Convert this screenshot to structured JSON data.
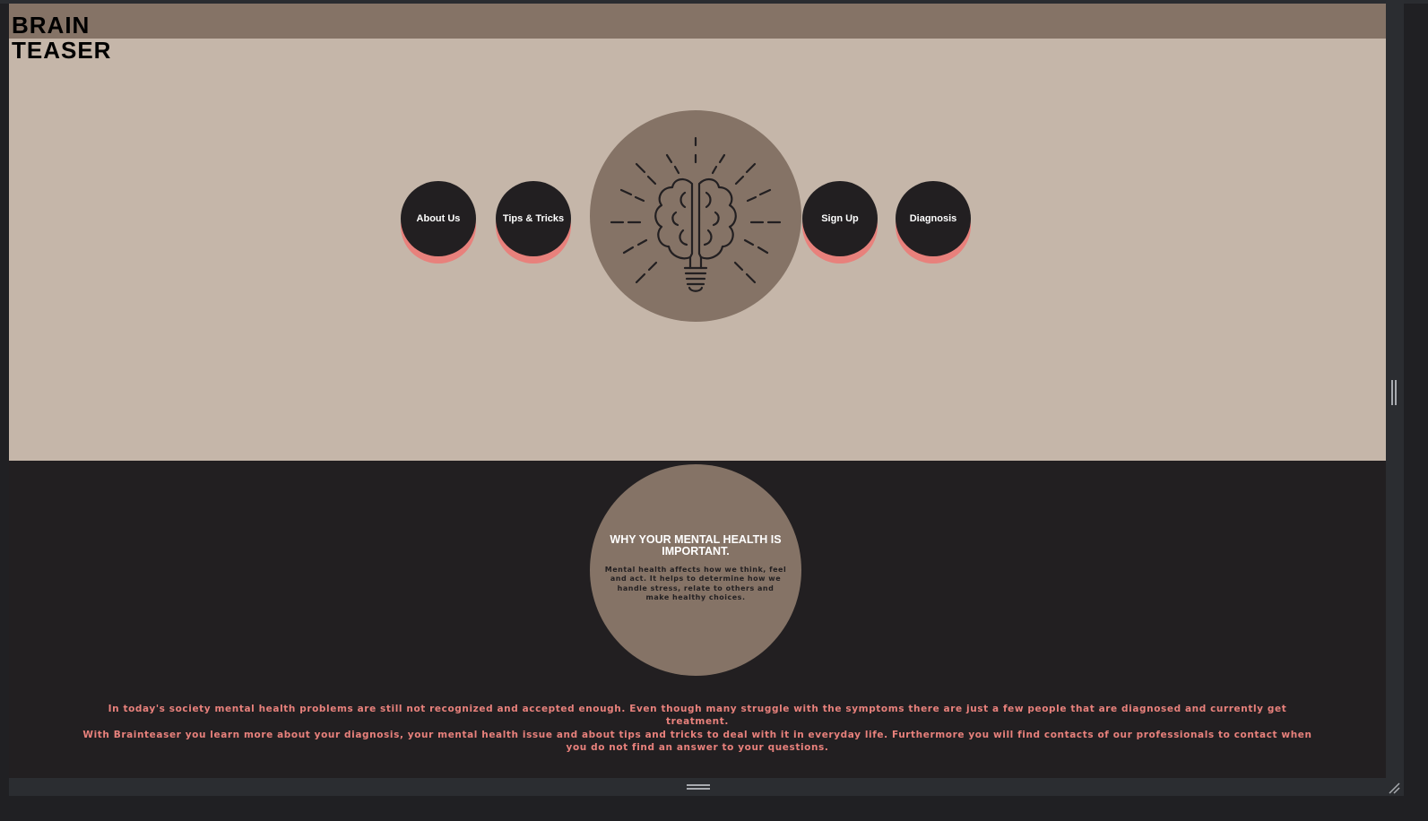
{
  "brand": {
    "line1": "BRAIN",
    "line2": "TEASER"
  },
  "nav": {
    "about": "About Us",
    "tips": "Tips & Tricks",
    "signup": "Sign Up",
    "diagnosis": "Diagnosis"
  },
  "info": {
    "title": "WHY YOUR MENTAL HEALTH IS IMPORTANT.",
    "text": "Mental health affects how we think, feel and act. It helps to determine how we handle stress, relate to others and make healthy choices."
  },
  "body": {
    "paragraph1": "In today's society mental health problems are still not recognized and accepted enough. Even though many struggle with the symptoms there are just a few people that are diagnosed and currently get treatment.",
    "paragraph2": "With Brainteaser you learn more about your diagnosis, your mental health issue and about tips and tricks to deal with it in everyday life. Furthermore you will find contacts of our professionals to contact when you do not find an answer to your questions."
  },
  "icons": {
    "hero": "lightbulb-brain-icon"
  },
  "colors": {
    "header": "#857366",
    "hero_bg": "#c5b6a9",
    "dark": "#221f21",
    "accent": "#e8817c",
    "circle": "#857366"
  }
}
